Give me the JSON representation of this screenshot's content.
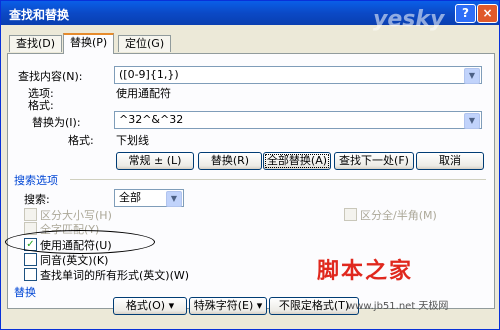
{
  "window": {
    "title": "查找和替换",
    "help_glyph": "?",
    "close_glyph": "×"
  },
  "tabs": [
    "查找(D)",
    "替换(P)",
    "定位(G)"
  ],
  "find": {
    "label": "查找内容(N):",
    "value": "([0-9]{1,})",
    "options_label": "选项:",
    "options_value": "使用通配符",
    "format_label": "格式:"
  },
  "replace": {
    "label": "替换为(I):",
    "value": "^32^&^32",
    "format_label": "格式:",
    "format_value": "下划线"
  },
  "buttons": {
    "less": "常规 ± (L)",
    "replace": "替换(R)",
    "replace_all": "全部替换(A)",
    "find_next": "查找下一处(F)",
    "cancel": "取消"
  },
  "search_options": {
    "section_label": "搜索选项",
    "search_label": "搜索:",
    "search_value": "全部",
    "match_case": "区分大小写(H)",
    "whole_word": "全字匹配(Y)",
    "full_half": "区分全/半角(M)",
    "wildcards": "使用通配符(U)",
    "sounds_like": "同音(英文)(K)",
    "word_forms": "查找单词的所有形式(英文)(W)"
  },
  "replace_section": {
    "label": "替换",
    "format_btn": "格式(O) ▾",
    "special_btn": "特殊字符(E) ▾",
    "no_format_btn": "不限定格式(T)"
  },
  "watermarks": {
    "yesky": "yesky",
    "jiaoben": "脚本之家",
    "url": "www.jb51.net   天极网"
  },
  "colors": {
    "title_bar": "#0b49c6",
    "section_text": "#0046d5",
    "check_mark": "#21a121"
  }
}
